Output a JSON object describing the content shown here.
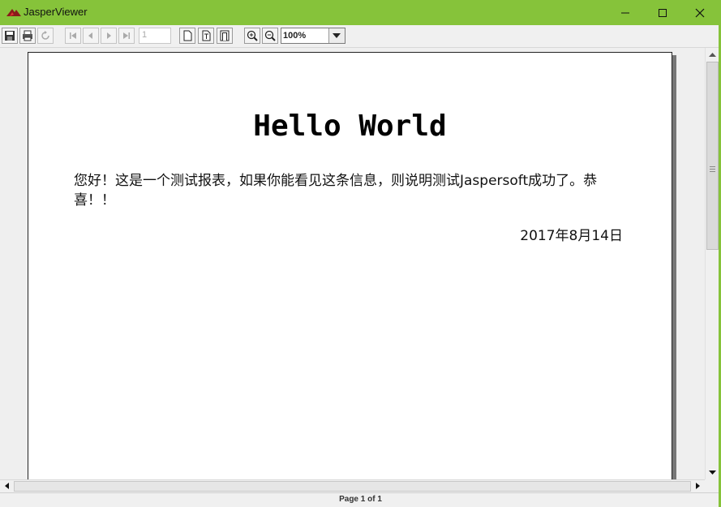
{
  "window": {
    "title": "JasperViewer",
    "title_bar_color": "#86c33a"
  },
  "toolbar": {
    "buttons": [
      {
        "name": "save-button",
        "icon": "floppy-disk-icon"
      },
      {
        "name": "print-button",
        "icon": "printer-icon"
      },
      {
        "name": "reload-button",
        "icon": "refresh-icon"
      },
      {
        "name": "first-page-button",
        "icon": "first-page-icon"
      },
      {
        "name": "previous-page-button",
        "icon": "previous-icon"
      },
      {
        "name": "next-page-button",
        "icon": "next-icon"
      },
      {
        "name": "last-page-button",
        "icon": "last-page-icon"
      },
      {
        "name": "actual-size-button",
        "icon": "actual-size-icon"
      },
      {
        "name": "fit-page-button",
        "icon": "fit-page-icon"
      },
      {
        "name": "fit-width-button",
        "icon": "fit-width-icon"
      },
      {
        "name": "zoom-in-button",
        "icon": "zoom-in-icon"
      },
      {
        "name": "zoom-out-button",
        "icon": "zoom-out-icon"
      }
    ],
    "page_number": "1",
    "zoom": "100%"
  },
  "report": {
    "title": "Hello World",
    "body": "您好！这是一个测试报表，如果你能看见这条信息，则说明测试Jaspersoft成功了。恭喜！！",
    "date": "2017年8月14日"
  },
  "status": {
    "page_label": "Page 1 of 1"
  }
}
